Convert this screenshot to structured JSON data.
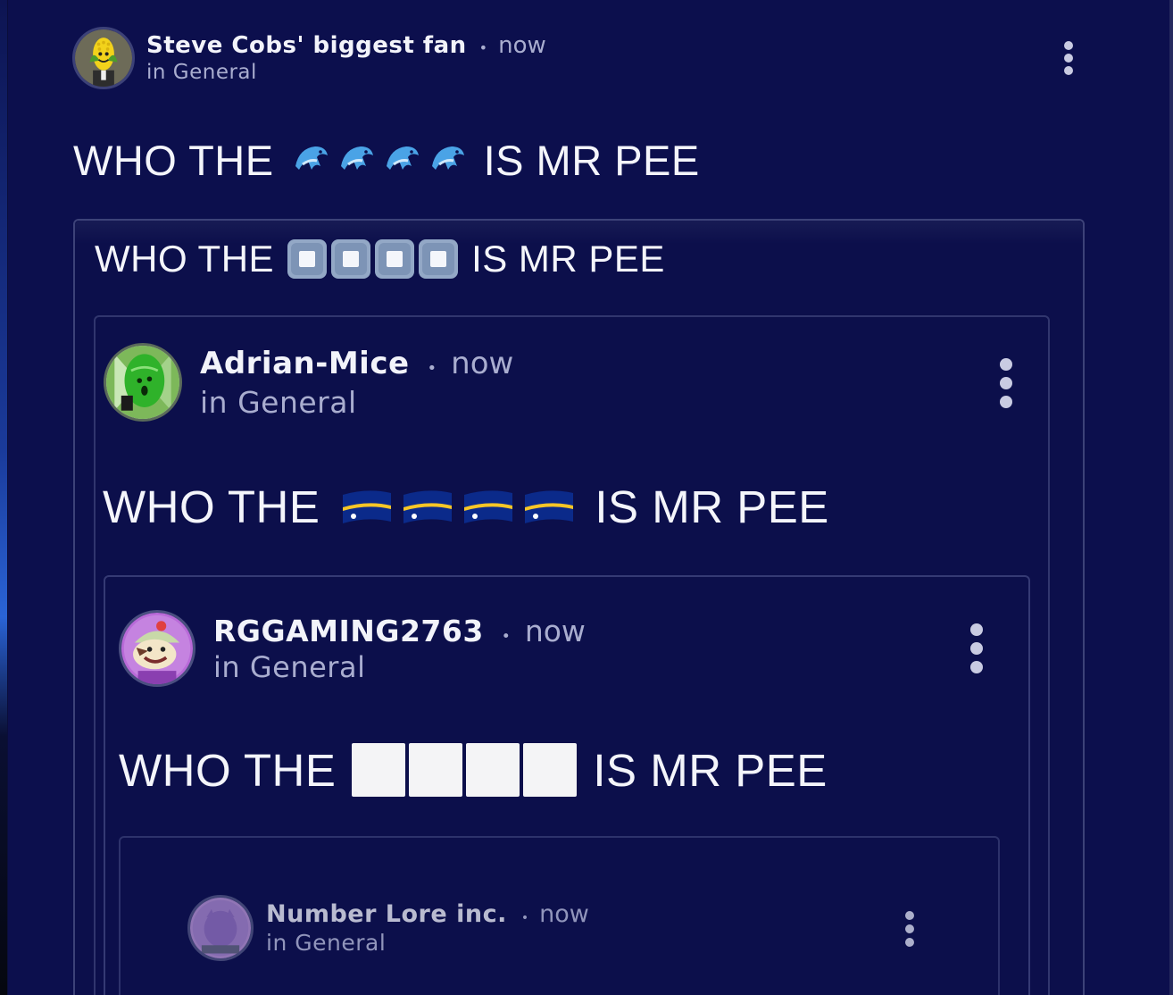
{
  "posts": [
    {
      "author": "Steve Cobs' biggest fan",
      "separator": "•",
      "time": "now",
      "channel": "in General",
      "avatar_icon": "corn-avatar-icon",
      "text_before": "WHO THE",
      "glyph": "dolphin-emoji",
      "glyph_count": 4,
      "text_after": "IS MR PEE"
    },
    {
      "quoted_text_before": "WHO THE",
      "glyph": "grey-square-emoji",
      "glyph_count": 4,
      "quoted_text_after": "IS MR PEE"
    },
    {
      "author": "Adrian-Mice",
      "separator": "•",
      "time": "now",
      "channel": "in General",
      "avatar_icon": "green-shield-avatar-icon",
      "text_before": "WHO THE",
      "glyph": "nauru-flag-emoji",
      "glyph_count": 4,
      "text_after": "IS MR PEE"
    },
    {
      "author": "RGGAMING2763",
      "separator": "•",
      "time": "now",
      "channel": "in General",
      "avatar_icon": "purple-character-avatar-icon",
      "text_before": "WHO THE",
      "glyph": "white-box-glyph",
      "glyph_count": 4,
      "text_after": "IS MR PEE"
    },
    {
      "author": "Number Lore inc.",
      "separator": "•",
      "time": "now",
      "channel": "in General",
      "avatar_icon": "purple-blob-avatar-icon"
    }
  ],
  "icons": {
    "more": "kebab-menu-icon"
  },
  "colors": {
    "background": "#0c0f4d",
    "text": "#f2f3fa",
    "muted": "#a9adcf"
  }
}
